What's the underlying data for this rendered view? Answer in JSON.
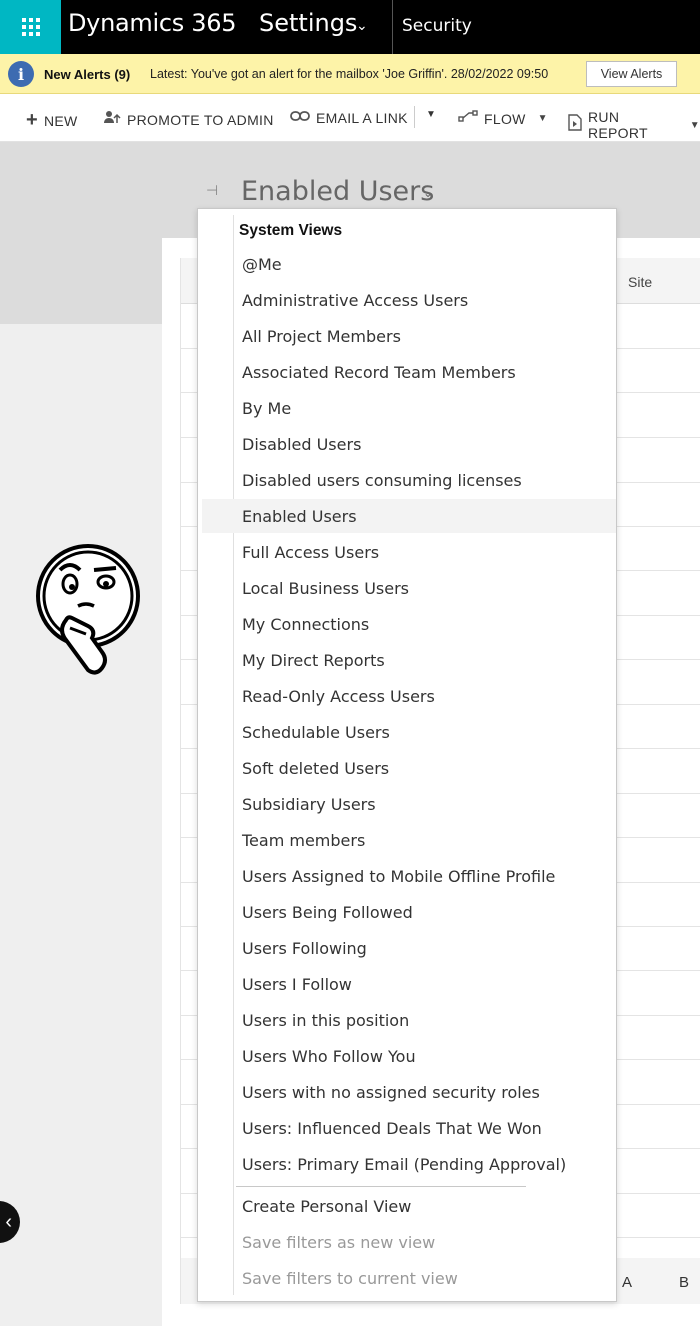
{
  "topnav": {
    "app_title": "Dynamics 365",
    "area": "Settings",
    "page": "Security"
  },
  "alerts": {
    "title": "New Alerts (9)",
    "text": "Latest: You've got an alert for the mailbox 'Joe Griffin'. 28/02/2022 09:50",
    "button": "View Alerts"
  },
  "commands": {
    "new": "NEW",
    "promote": "PROMOTE TO ADMIN",
    "email": "EMAIL A LINK",
    "flow": "FLOW",
    "run_report": "RUN REPORT"
  },
  "view": {
    "title": "Enabled Users"
  },
  "grid": {
    "site_header": "Site",
    "footer_letters": [
      "A",
      "B"
    ]
  },
  "dropdown": {
    "header": "System Views",
    "selected": "Enabled Users",
    "items": [
      "@Me",
      "Administrative Access Users",
      "All Project Members",
      "Associated Record Team Members",
      "By Me",
      "Disabled Users",
      "Disabled users consuming licenses",
      "Enabled Users",
      "Full Access Users",
      "Local Business Users",
      "My Connections",
      "My Direct Reports",
      "Read-Only Access Users",
      "Schedulable Users",
      "Soft deleted Users",
      "Subsidiary Users",
      "Team members",
      "Users Assigned to Mobile Offline Profile",
      "Users Being Followed",
      "Users Following",
      "Users I Follow",
      "Users in this position",
      "Users Who Follow You",
      "Users with no assigned security roles",
      "Users: Influenced Deals That We Won",
      "Users: Primary Email (Pending Approval)"
    ],
    "actions": [
      {
        "label": "Create Personal View",
        "enabled": true
      },
      {
        "label": "Save filters as new view",
        "enabled": false
      },
      {
        "label": "Save filters to current view",
        "enabled": false
      }
    ]
  },
  "colors": {
    "waffle": "#00b7c3",
    "alert_bar": "#fdf3a8",
    "alert_icon": "#3d6bb1"
  }
}
